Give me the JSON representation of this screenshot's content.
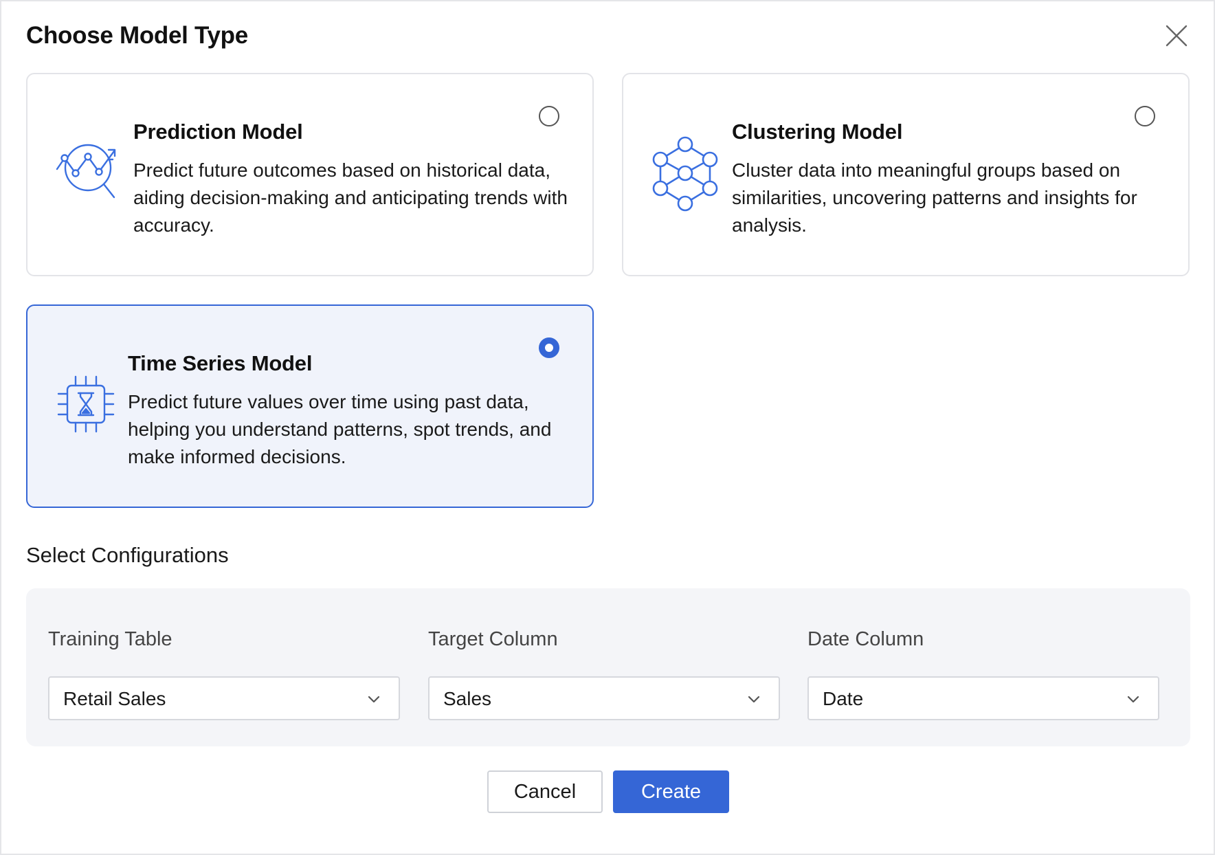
{
  "dialog": {
    "title": "Choose Model Type",
    "close_icon": "close-icon"
  },
  "model_types": [
    {
      "title": "Prediction Model",
      "description": "Predict future outcomes based on historical data, aiding decision-making and anticipating trends with accuracy.",
      "icon": "prediction-chart-magnifier-icon",
      "selected": false
    },
    {
      "title": "Clustering Model",
      "description": "Cluster data into meaningful groups based on similarities, uncovering patterns and insights for analysis.",
      "icon": "cluster-network-icon",
      "selected": false
    },
    {
      "title": "Time Series Model",
      "description": "Predict future values over time using past data, helping you understand patterns, spot trends, and make informed decisions.",
      "icon": "hourglass-chip-icon",
      "selected": true
    }
  ],
  "configurations": {
    "section_title": "Select Configurations",
    "fields": [
      {
        "label": "Training Table",
        "value": "Retail Sales"
      },
      {
        "label": "Target Column",
        "value": "Sales"
      },
      {
        "label": "Date Column",
        "value": "Date"
      }
    ]
  },
  "actions": {
    "cancel_label": "Cancel",
    "create_label": "Create"
  },
  "colors": {
    "accent": "#3566d6",
    "selected_card_bg": "#f0f3fb",
    "panel_bg": "#f4f5f8",
    "icon_stroke": "#3a6fe0"
  }
}
